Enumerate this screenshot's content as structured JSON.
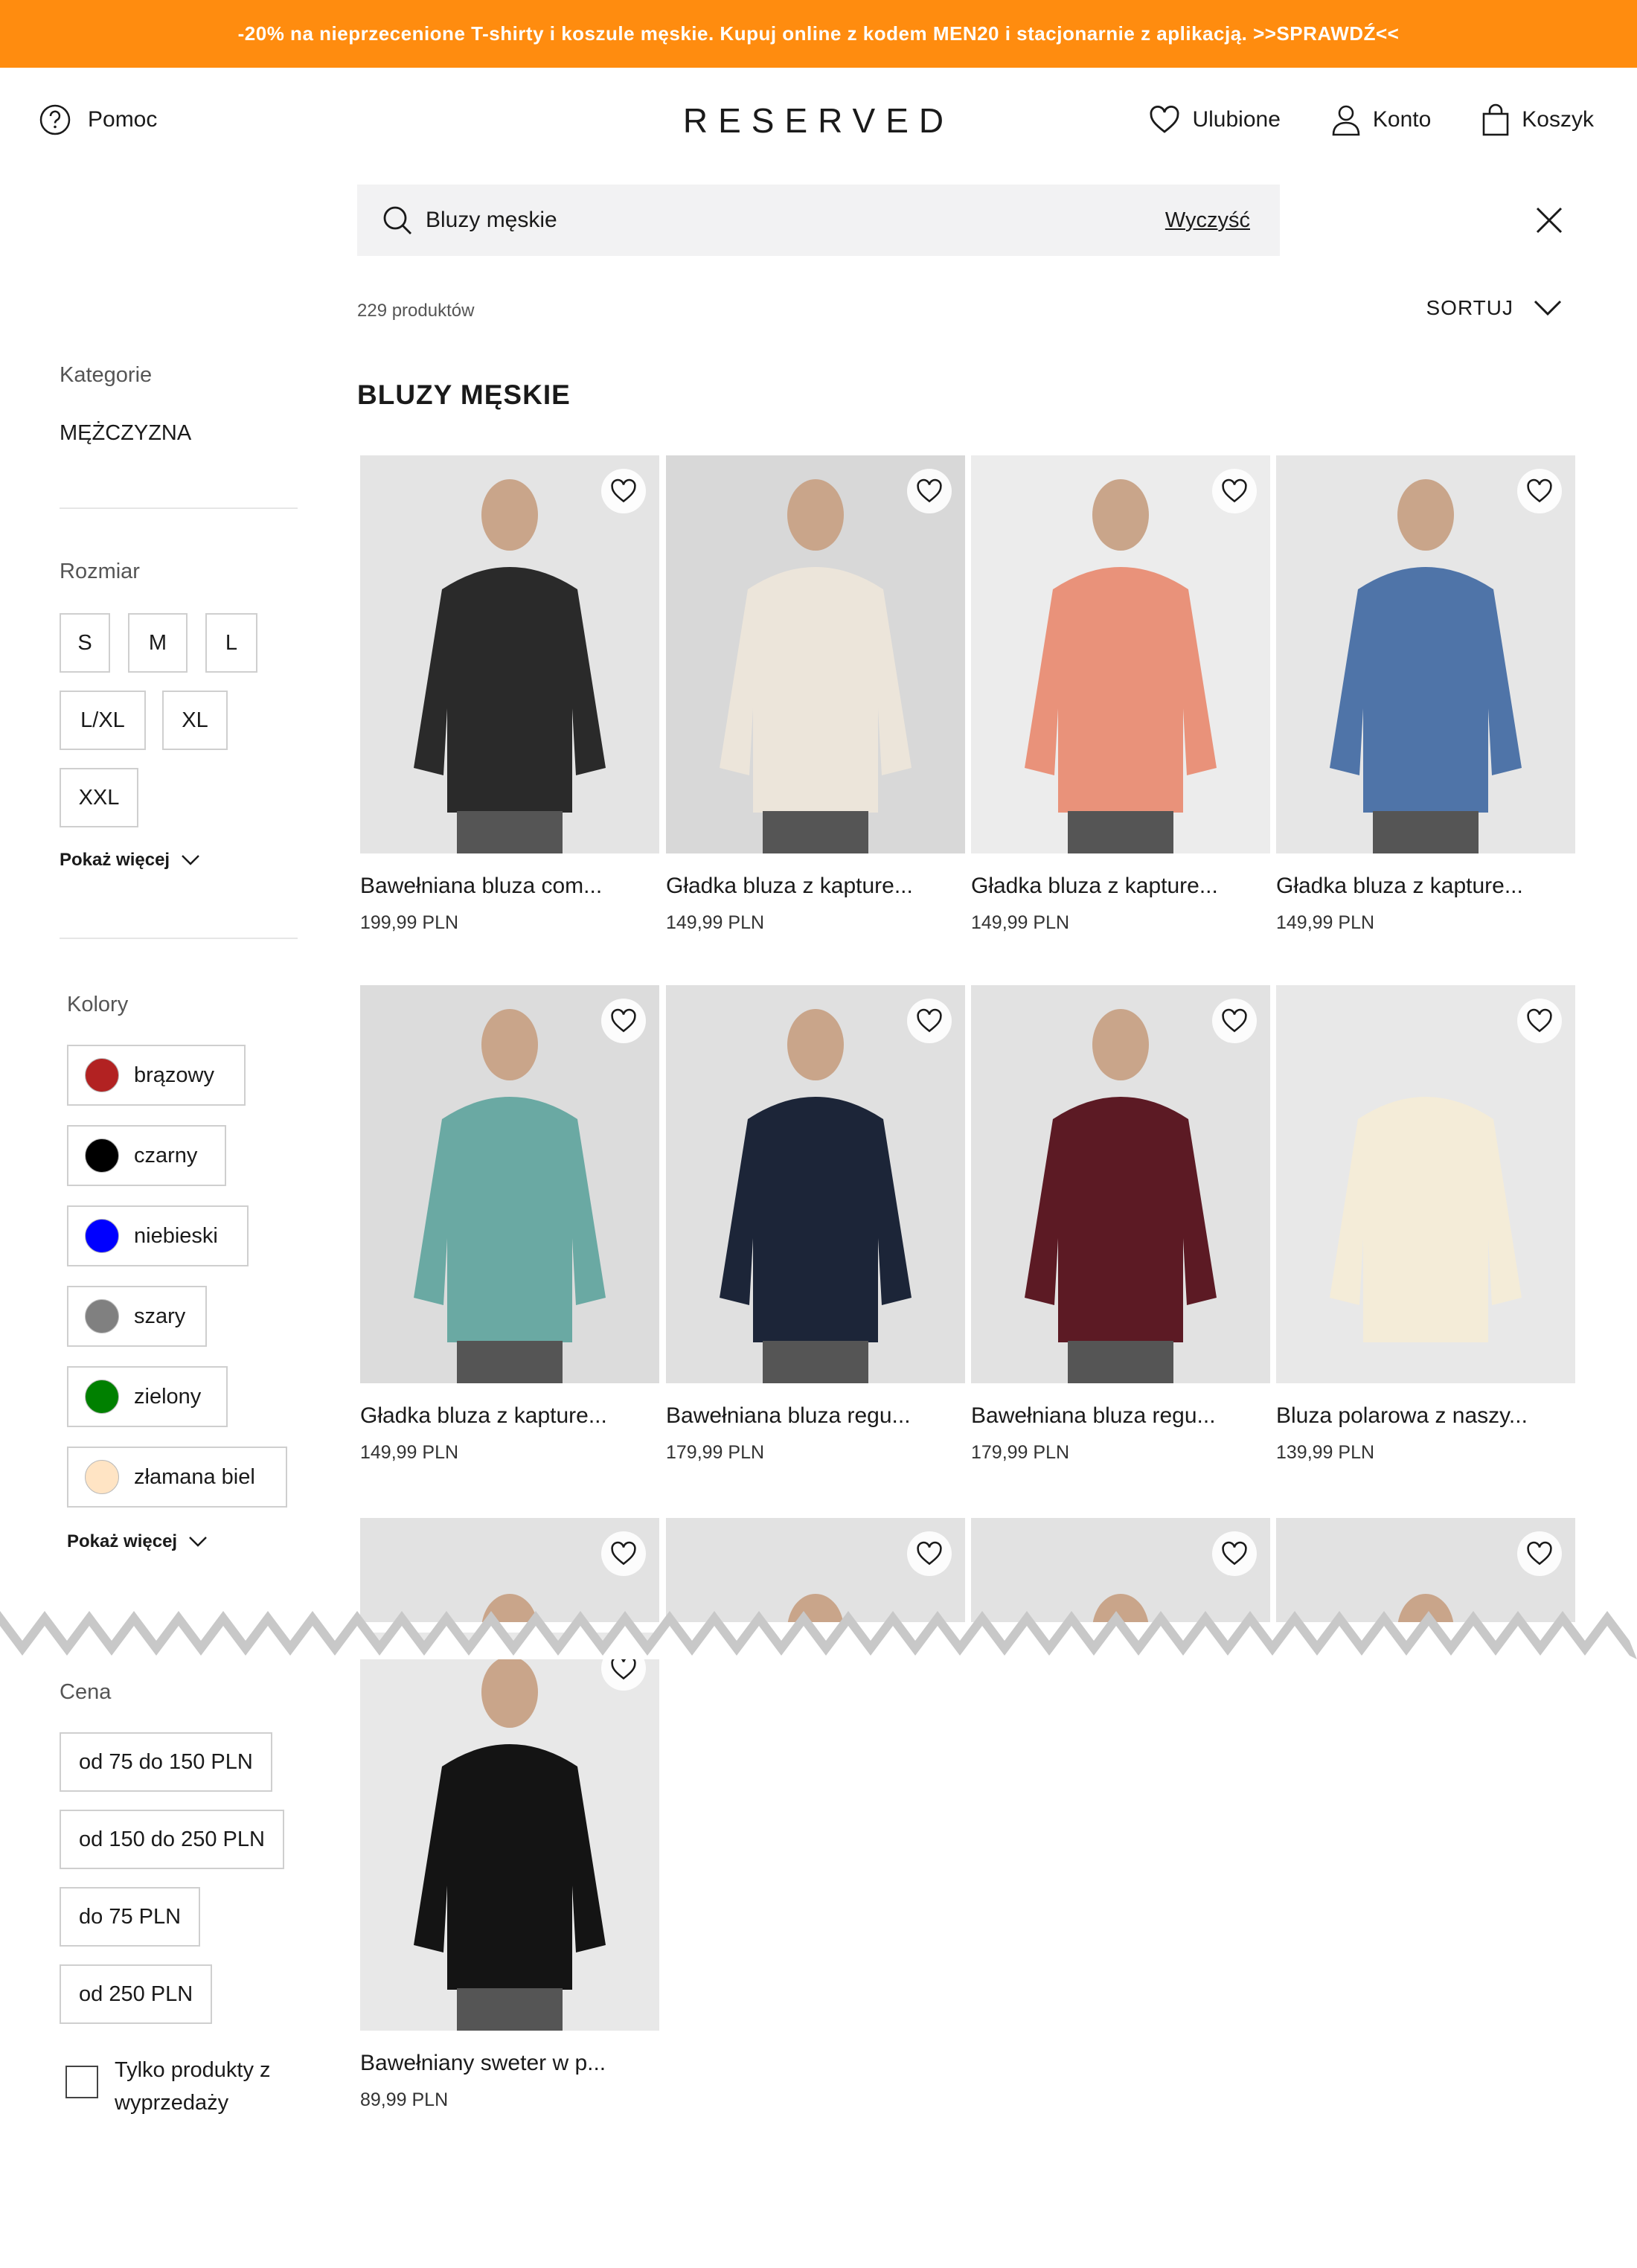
{
  "promo": {
    "text": "-20% na nieprzecenione T-shirty i koszule męskie. Kupuj online z kodem MEN20 i stacjonarnie z aplikacją. >>SPRAWDŹ<<",
    "bg": "#ff8c0f"
  },
  "header": {
    "help_label": "Pomoc",
    "logo": "RESERVED",
    "favorites_label": "Ulubione",
    "account_label": "Konto",
    "cart_label": "Koszyk"
  },
  "search": {
    "value": "Bluzy męskie",
    "clear_label": "Wyczyść"
  },
  "results": {
    "count_label": "229 produktów",
    "sort_label": "SORTUJ",
    "title": "BLUZY MĘSKIE"
  },
  "filters": {
    "categories_label": "Kategorie",
    "category": "MĘŻCZYZNA",
    "size_label": "Rozmiar",
    "sizes": [
      "S",
      "M",
      "L",
      "L/XL",
      "XL",
      "XXL"
    ],
    "show_more_label": "Pokaż więcej",
    "colors_label": "Kolory",
    "colors": [
      {
        "name": "brązowy",
        "hex": "#b22222"
      },
      {
        "name": "czarny",
        "hex": "#000000"
      },
      {
        "name": "niebieski",
        "hex": "#0000ff"
      },
      {
        "name": "szary",
        "hex": "#808080"
      },
      {
        "name": "zielony",
        "hex": "#008000"
      },
      {
        "name": "złamana biel",
        "hex": "#ffe4c4"
      }
    ],
    "price_label": "Cena",
    "prices": [
      "od 75 do 150 PLN",
      "od 150 do 250 PLN",
      "do 75 PLN",
      "od 250 PLN"
    ],
    "sale_only_label": "Tylko produkty z wyprzedaży"
  },
  "products": [
    {
      "name": "Bawełniana bluza com...",
      "price": "199,99 PLN",
      "color": "#2a2a2a",
      "bg": "#e4e4e4"
    },
    {
      "name": "Gładka bluza z kapture...",
      "price": "149,99 PLN",
      "color": "#ece5da",
      "bg": "#d8d8d8"
    },
    {
      "name": "Gładka bluza z kapture...",
      "price": "149,99 PLN",
      "color": "#e9927a",
      "bg": "#ececec"
    },
    {
      "name": "Gładka bluza z kapture...",
      "price": "149,99 PLN",
      "color": "#4f74a8",
      "bg": "#e6e6e6"
    },
    {
      "name": "Gładka bluza z kapture...",
      "price": "149,99 PLN",
      "color": "#6aa9a3",
      "bg": "#dcdcdc"
    },
    {
      "name": "Bawełniana bluza regu...",
      "price": "179,99 PLN",
      "color": "#1c2538",
      "bg": "#e0e0e0"
    },
    {
      "name": "Bawełniana bluza regu...",
      "price": "179,99 PLN",
      "color": "#5c1a24",
      "bg": "#e2e2e2"
    },
    {
      "name": "Bluza polarowa z naszy...",
      "price": "139,99 PLN",
      "color": "#f4ecd8",
      "bg": "#e8e8e8"
    },
    {
      "name": "",
      "price": "",
      "color": "#3d4a34",
      "bg": "#e2e2e2"
    },
    {
      "name": "",
      "price": "",
      "color": "#8c2f2f",
      "bg": "#e2e2e2"
    },
    {
      "name": "",
      "price": "",
      "color": "#1a1a22",
      "bg": "#e2e2e2"
    },
    {
      "name": "",
      "price": "",
      "color": "#4a4550",
      "bg": "#e2e2e2"
    },
    {
      "name": "Bawełniany sweter w p...",
      "price": "89,99 PLN",
      "color": "#141414",
      "bg": "#e8e8e8"
    }
  ]
}
